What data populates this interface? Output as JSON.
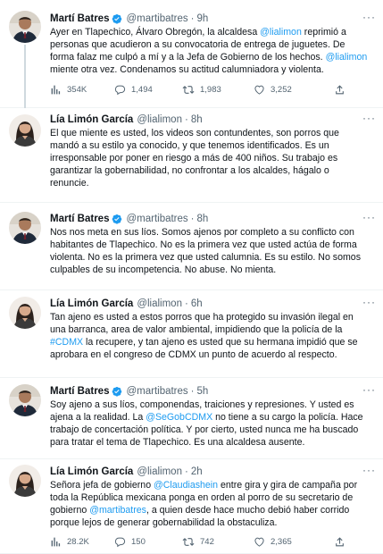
{
  "colors": {
    "link": "#1d9bf0",
    "muted": "#536471",
    "verified": "#1d9bf0"
  },
  "icons": [
    "verified-badge-icon",
    "analytics-icon",
    "reply-icon",
    "retweet-icon",
    "like-icon",
    "share-icon",
    "more-icon"
  ],
  "tweets": [
    {
      "name": "Martí Batres",
      "verified": true,
      "handle": "@martibatres",
      "time": "9h",
      "segments": [
        {
          "t": "Ayer en Tlapechico, Álvaro Obregón, la alcaldesa ",
          "link": false
        },
        {
          "t": "@lialimon",
          "link": true
        },
        {
          "t": " reprimió a personas que acudieron a su convocatoria de entrega de juguetes. De forma falaz me culpó a mí y a la Jefa de Gobierno de los hechos. ",
          "link": false
        },
        {
          "t": "@lialimon",
          "link": true
        },
        {
          "t": " miente otra vez. Condenamos su actitud calumniadora y violenta.",
          "link": false
        }
      ],
      "stats": {
        "views": "354K",
        "replies": "1,494",
        "retweets": "1,983",
        "likes": "3,252"
      }
    },
    {
      "name": "Lía Limón García",
      "verified": false,
      "handle": "@lialimon",
      "time": "8h",
      "segments": [
        {
          "t": "El que miente es usted, los videos son contundentes, son porros que mandó a su estilo ya conocido, y que tenemos identificados. Es un irresponsable por poner en riesgo a más de 400 niños. Su trabajo es garantizar la gobernabilidad, no confrontar a los alcaldes, hágalo o renuncie.",
          "link": false
        }
      ]
    },
    {
      "name": "Martí Batres",
      "verified": true,
      "handle": "@martibatres",
      "time": "8h",
      "segments": [
        {
          "t": "Nos nos meta en sus líos. Somos ajenos por completo a su conflicto con habitantes de Tlapechico. No es la primera vez que usted actúa de forma violenta. No es la primera vez que usted calumnia. Es su estilo. No somos culpables de su incompetencia. No abuse. No mienta.",
          "link": false
        }
      ]
    },
    {
      "name": "Lía Limón García",
      "verified": false,
      "handle": "@lialimon",
      "time": "6h",
      "segments": [
        {
          "t": "Tan ajeno es usted a estos porros que ha protegido su invasión ilegal en una barranca, area de valor ambiental, impidiendo que la policía de la ",
          "link": false
        },
        {
          "t": "#CDMX",
          "link": true
        },
        {
          "t": " la recupere, y tan ajeno es usted que su hermana impidió que se aprobara en el congreso de CDMX un punto de acuerdo al respecto.",
          "link": false
        }
      ]
    },
    {
      "name": "Martí Batres",
      "verified": true,
      "handle": "@martibatres",
      "time": "5h",
      "segments": [
        {
          "t": "Soy ajeno a sus líos, componendas, traiciones y represiones. Y usted es ajena a la realidad. La ",
          "link": false
        },
        {
          "t": "@SeGobCDMX",
          "link": true
        },
        {
          "t": " no tiene a su cargo la policía. Hace trabajo de concertación política. Y por cierto, usted nunca me ha buscado para tratar el tema de Tlapechico. Es una alcaldesa ausente.",
          "link": false
        }
      ]
    },
    {
      "name": "Lía Limón García",
      "verified": false,
      "handle": "@lialimon",
      "time": "2h",
      "segments": [
        {
          "t": "Señora jefa de gobierno ",
          "link": false
        },
        {
          "t": "@Claudiashein",
          "link": true
        },
        {
          "t": " entre gira y gira de campaña por toda la República mexicana ponga en orden al porro de su secretario de gobierno ",
          "link": false
        },
        {
          "t": "@martibatres",
          "link": true
        },
        {
          "t": ", a quien desde hace mucho debió haber corrido porque lejos de generar gobernabilidad la obstaculiza.",
          "link": false
        }
      ],
      "stats": {
        "views": "28.2K",
        "replies": "150",
        "retweets": "742",
        "likes": "2,365"
      }
    }
  ]
}
